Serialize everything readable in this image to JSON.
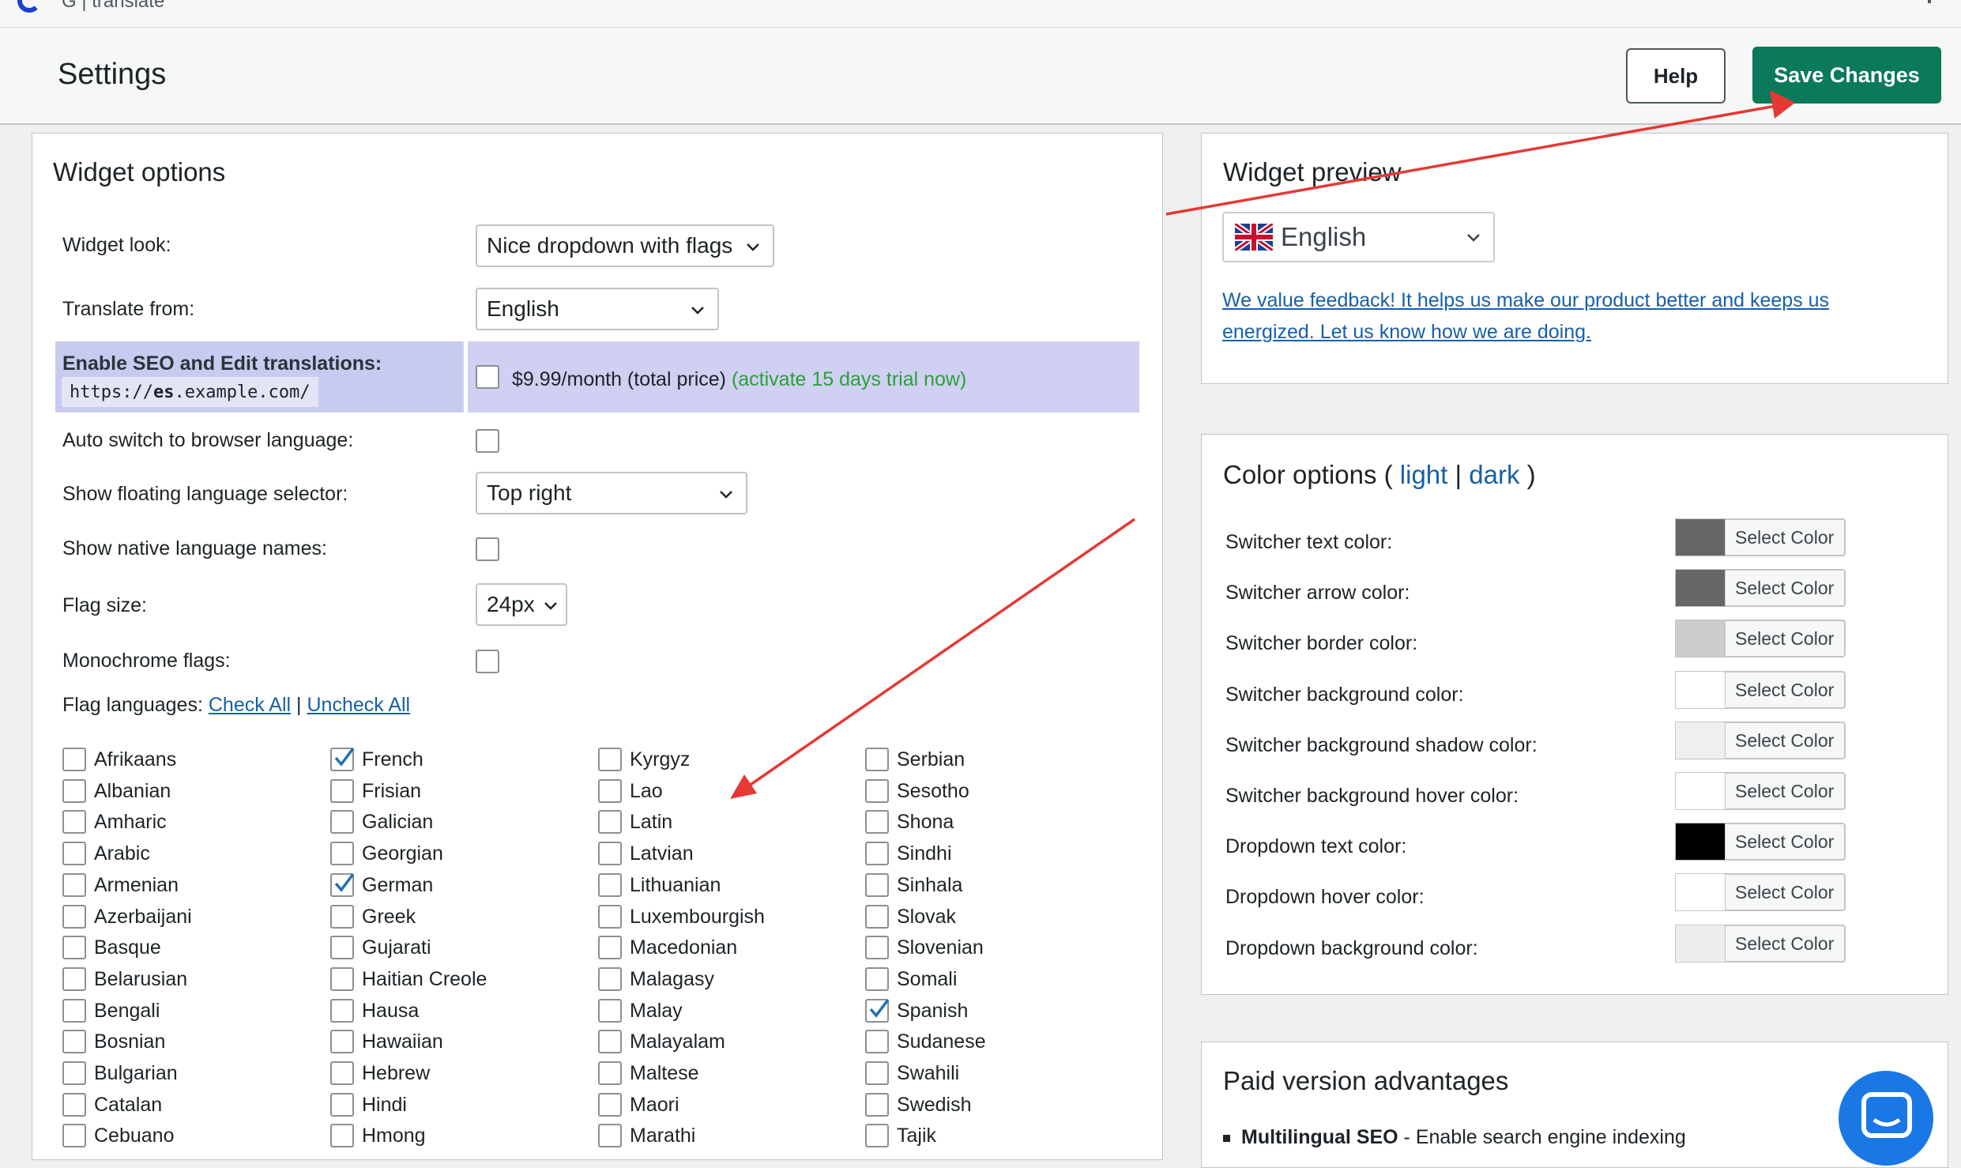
{
  "topbar": {
    "brand": "G | translate"
  },
  "header": {
    "title": "Settings",
    "help_label": "Help",
    "save_label": "Save Changes"
  },
  "widget_options": {
    "title": "Widget options",
    "widget_look_label": "Widget look:",
    "widget_look_value": "Nice dropdown with flags",
    "translate_from_label": "Translate from:",
    "translate_from_value": "English",
    "seo_label": "Enable SEO and Edit translations:",
    "seo_url_prefix": "https://",
    "seo_url_bold": "es",
    "seo_url_suffix": ".example.com/",
    "seo_price": "$9.99/month (total price)",
    "seo_trial": "(activate 15 days trial now)",
    "auto_switch_label": "Auto switch to browser language:",
    "floating_label": "Show floating language selector:",
    "floating_value": "Top right",
    "native_names_label": "Show native language names:",
    "flag_size_label": "Flag size:",
    "flag_size_value": "24px",
    "monochrome_label": "Monochrome flags:",
    "flag_languages_label": "Flag languages:",
    "check_all": "Check All",
    "separator": "|",
    "uncheck_all": "Uncheck All",
    "languages": [
      [
        {
          "name": "Afrikaans",
          "checked": false
        },
        {
          "name": "Albanian",
          "checked": false
        },
        {
          "name": "Amharic",
          "checked": false
        },
        {
          "name": "Arabic",
          "checked": false
        },
        {
          "name": "Armenian",
          "checked": false
        },
        {
          "name": "Azerbaijani",
          "checked": false
        },
        {
          "name": "Basque",
          "checked": false
        },
        {
          "name": "Belarusian",
          "checked": false
        },
        {
          "name": "Bengali",
          "checked": false
        },
        {
          "name": "Bosnian",
          "checked": false
        },
        {
          "name": "Bulgarian",
          "checked": false
        },
        {
          "name": "Catalan",
          "checked": false
        },
        {
          "name": "Cebuano",
          "checked": false
        }
      ],
      [
        {
          "name": "French",
          "checked": true
        },
        {
          "name": "Frisian",
          "checked": false
        },
        {
          "name": "Galician",
          "checked": false
        },
        {
          "name": "Georgian",
          "checked": false
        },
        {
          "name": "German",
          "checked": true
        },
        {
          "name": "Greek",
          "checked": false
        },
        {
          "name": "Gujarati",
          "checked": false
        },
        {
          "name": "Haitian Creole",
          "checked": false
        },
        {
          "name": "Hausa",
          "checked": false
        },
        {
          "name": "Hawaiian",
          "checked": false
        },
        {
          "name": "Hebrew",
          "checked": false
        },
        {
          "name": "Hindi",
          "checked": false
        },
        {
          "name": "Hmong",
          "checked": false
        }
      ],
      [
        {
          "name": "Kyrgyz",
          "checked": false
        },
        {
          "name": "Lao",
          "checked": false
        },
        {
          "name": "Latin",
          "checked": false
        },
        {
          "name": "Latvian",
          "checked": false
        },
        {
          "name": "Lithuanian",
          "checked": false
        },
        {
          "name": "Luxembourgish",
          "checked": false
        },
        {
          "name": "Macedonian",
          "checked": false
        },
        {
          "name": "Malagasy",
          "checked": false
        },
        {
          "name": "Malay",
          "checked": false
        },
        {
          "name": "Malayalam",
          "checked": false
        },
        {
          "name": "Maltese",
          "checked": false
        },
        {
          "name": "Maori",
          "checked": false
        },
        {
          "name": "Marathi",
          "checked": false
        }
      ],
      [
        {
          "name": "Serbian",
          "checked": false
        },
        {
          "name": "Sesotho",
          "checked": false
        },
        {
          "name": "Shona",
          "checked": false
        },
        {
          "name": "Sindhi",
          "checked": false
        },
        {
          "name": "Sinhala",
          "checked": false
        },
        {
          "name": "Slovak",
          "checked": false
        },
        {
          "name": "Slovenian",
          "checked": false
        },
        {
          "name": "Somali",
          "checked": false
        },
        {
          "name": "Spanish",
          "checked": true
        },
        {
          "name": "Sudanese",
          "checked": false
        },
        {
          "name": "Swahili",
          "checked": false
        },
        {
          "name": "Swedish",
          "checked": false
        },
        {
          "name": "Tajik",
          "checked": false
        }
      ]
    ]
  },
  "widget_preview": {
    "title": "Widget preview",
    "language": "English",
    "feedback": "We value feedback! It helps us make our product better and keeps us energized. Let us know how we are doing."
  },
  "color_options": {
    "title_prefix": "Color options (",
    "light": "light",
    "divider": "|",
    "dark": "dark",
    "title_suffix": ")",
    "select_label": "Select Color",
    "rows": [
      {
        "label": "Switcher text color:",
        "color": "#666666"
      },
      {
        "label": "Switcher arrow color:",
        "color": "#666666"
      },
      {
        "label": "Switcher border color:",
        "color": "#cccccc"
      },
      {
        "label": "Switcher background color:",
        "color": "#ffffff"
      },
      {
        "label": "Switcher background shadow color:",
        "color": "#efefef"
      },
      {
        "label": "Switcher background hover color:",
        "color": "#ffffff"
      },
      {
        "label": "Dropdown text color:",
        "color": "#000000"
      },
      {
        "label": "Dropdown hover color:",
        "color": "#ffffff"
      },
      {
        "label": "Dropdown background color:",
        "color": "#eeeeee"
      }
    ]
  },
  "paid": {
    "title": "Paid version advantages",
    "item_bold": "Multilingual SEO",
    "item_rest": " - Enable search engine indexing"
  },
  "colors": {
    "accent": "#0a7a5a",
    "link": "#1760a8",
    "seo_bg": "#cfd0f2",
    "arrow": "#e53935"
  }
}
